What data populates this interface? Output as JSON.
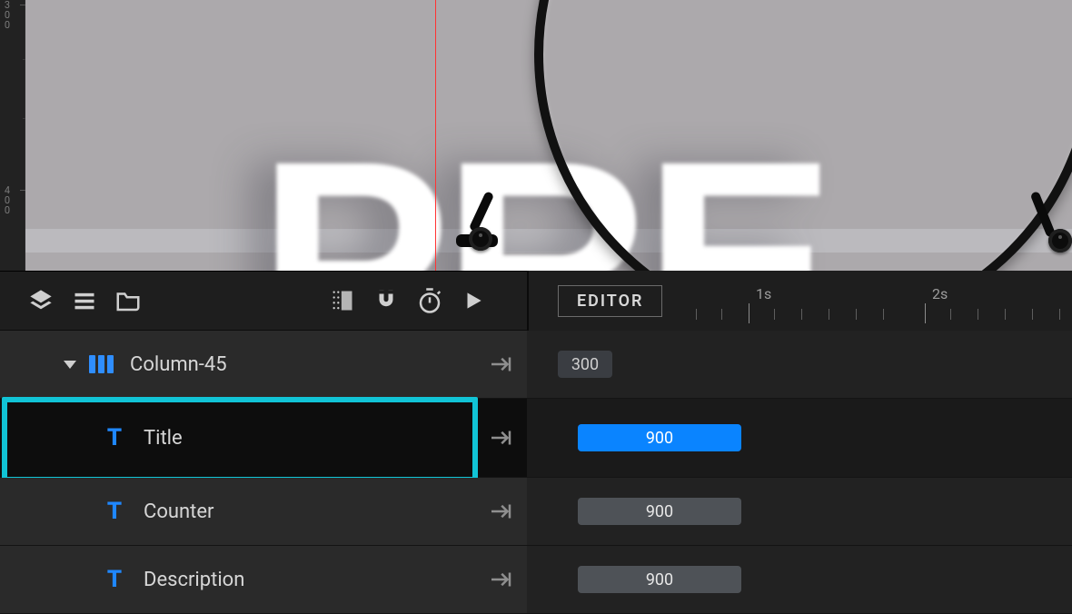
{
  "ruler": {
    "marks": [
      "300",
      "400"
    ]
  },
  "preview": {
    "placeholder_text": "PRE"
  },
  "toolbar": {
    "editor_chip": "EDITOR",
    "time_marks": [
      "1s",
      "2s"
    ]
  },
  "rows": {
    "parent": {
      "label": "Column-45",
      "clip_value": "300"
    },
    "children": [
      {
        "label": "Title",
        "clip_value": "900",
        "selected": true
      },
      {
        "label": "Counter",
        "clip_value": "900",
        "selected": false
      },
      {
        "label": "Description",
        "clip_value": "900",
        "selected": false
      }
    ]
  }
}
